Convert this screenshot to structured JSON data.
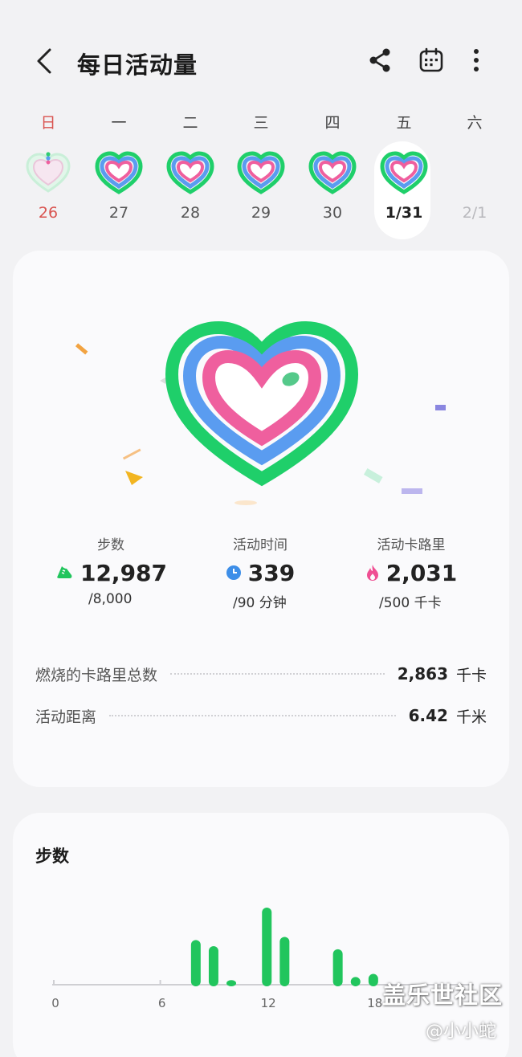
{
  "header": {
    "title": "每日活动量",
    "back_icon": "chevron-left-icon",
    "share_icon": "share-icon",
    "calendar_icon": "calendar-icon",
    "more_icon": "more-vertical-icon"
  },
  "week": [
    {
      "name": "日",
      "date": "26",
      "state": "sunday"
    },
    {
      "name": "一",
      "date": "27",
      "state": "normal"
    },
    {
      "name": "二",
      "date": "28",
      "state": "normal"
    },
    {
      "name": "三",
      "date": "29",
      "state": "normal"
    },
    {
      "name": "四",
      "date": "30",
      "state": "normal"
    },
    {
      "name": "五",
      "date": "1/31",
      "state": "selected"
    },
    {
      "name": "六",
      "date": "2/1",
      "state": "future"
    }
  ],
  "stats": {
    "steps": {
      "label": "步数",
      "value": "12,987",
      "goal": "/8,000",
      "icon": "shoe-icon"
    },
    "active_time": {
      "label": "活动时间",
      "value": "339",
      "goal": "/90 分钟",
      "icon": "clock-icon"
    },
    "active_calories": {
      "label": "活动卡路里",
      "value": "2,031",
      "goal": "/500 千卡",
      "icon": "flame-icon"
    }
  },
  "summary": {
    "total_calories": {
      "label": "燃烧的卡路里总数",
      "value": "2,863",
      "unit": "千卡"
    },
    "distance": {
      "label": "活动距离",
      "value": "6.42",
      "unit": "千米"
    }
  },
  "steps_section": {
    "title": "步数"
  },
  "chart_data": {
    "type": "bar",
    "title": "步数",
    "x_ticks": [
      "0",
      "6",
      "12",
      "18"
    ],
    "hours": [
      8,
      9,
      10,
      12,
      13,
      16,
      17,
      18
    ],
    "values": [
      0.58,
      0.5,
      0.06,
      1.0,
      0.62,
      0.46,
      0.1,
      0.14
    ],
    "color": "#21c55d"
  },
  "colors": {
    "ring_green": "#1fcf6a",
    "ring_blue": "#5a9cf0",
    "ring_pink": "#ef5f9e",
    "accent_red": "#d9534f"
  },
  "watermark": {
    "main": "盖乐世社区",
    "sub": "@小小蛇"
  }
}
